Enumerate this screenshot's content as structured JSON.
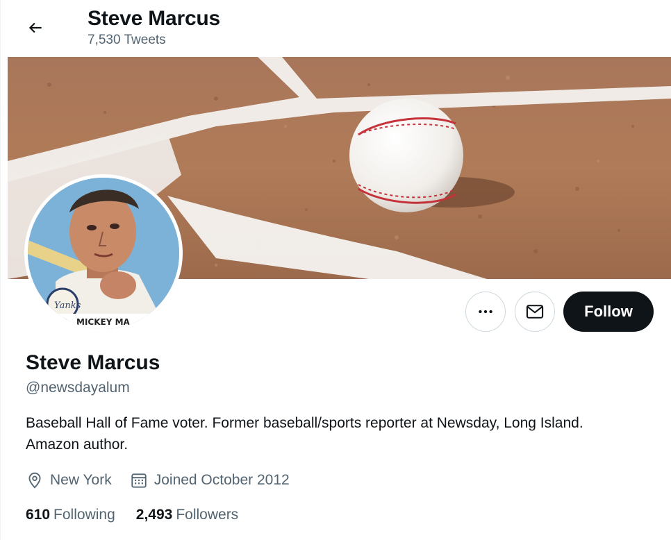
{
  "header": {
    "title": "Steve Marcus",
    "tweet_count": "7,530 Tweets",
    "back_icon": "arrow-left-icon"
  },
  "banner": {
    "description_icon": "baseball-on-dirt-field-image"
  },
  "avatar": {
    "card_text": "MICKEY MA"
  },
  "actions": {
    "more_icon": "ellipsis-icon",
    "message_icon": "envelope-icon",
    "follow_label": "Follow"
  },
  "profile": {
    "name": "Steve Marcus",
    "handle": "@newsdayalum",
    "bio": "Baseball Hall of Fame voter. Former baseball/sports reporter at Newsday, Long Island. Amazon author.",
    "location": "New York",
    "joined": "Joined October 2012"
  },
  "stats": {
    "following_count": "610",
    "following_label": "Following",
    "followers_count": "2,493",
    "followers_label": "Followers"
  },
  "colors": {
    "text_primary": "#0f1419",
    "text_secondary": "#536471",
    "border": "#cfd9de",
    "button_dark": "#0f1419"
  }
}
